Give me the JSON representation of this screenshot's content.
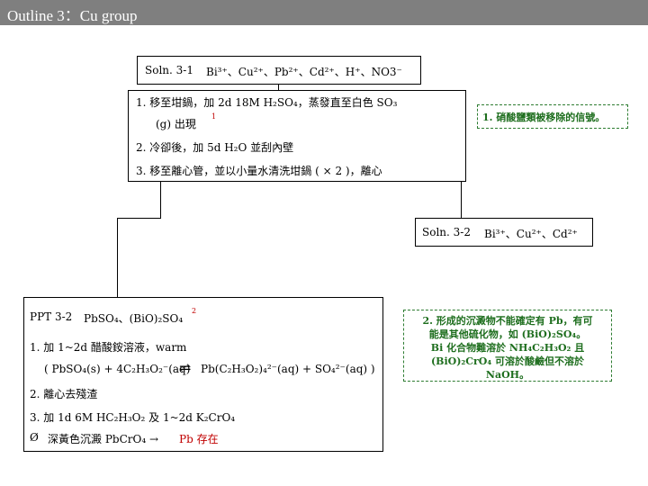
{
  "title": "Outline 3：Cu group",
  "soln31": {
    "label": "Soln. 3-1",
    "ions": "Bi³⁺、Cu²⁺、Pb²⁺、Cd²⁺、H⁺、NO3⁻"
  },
  "step1a": "1. 移至坩鍋，加 2d 18M H₂SO₄，蒸發直至白色 SO₃",
  "step1b": "(g) 出現",
  "step1_ref": "1",
  "step2": "2. 冷卻後，加 5d H₂O 並刮內壁",
  "step3": "3. 移至離心管，並以小量水清洗坩鍋 ( × 2 )，離心",
  "note1": "1. 硝酸鹽類被移除的信號。",
  "soln32": {
    "label": "Soln. 3-2",
    "ions": "Bi³⁺、Cu²⁺、Cd²⁺"
  },
  "ppt32": {
    "label": "PPT 3-2",
    "species": "PbSO₄、(BiO)₂SO₄",
    "ref": "2"
  },
  "ppt_step1": "1. 加 1~2d 醋酸銨溶液，warm",
  "equation": {
    "left": "( PbSO₄(s) + 4C₂H₃O₂⁻(aq)",
    "arrow": "⇌",
    "right": "Pb(C₂H₃O₂)₄²⁻(aq) + SO₄²⁻(aq) )"
  },
  "ppt_step2": "2. 離心去殘渣",
  "ppt_step3": "3. 加 1d 6M HC₂H₃O₂ 及 1~2d K₂CrO₄",
  "ppt_result": {
    "bullet": "Ø",
    "text": "深黃色沉澱 PbCrO₄ → ",
    "highlight": "Pb 存在"
  },
  "note2": [
    "2. 形成的沉澱物不能確定有 Pb，有可",
    "能是其他硫化物，如 (BiO)₂SO₄。",
    "Bi 化合物難溶於 NH₄C₂H₃O₂ 且",
    "(BiO)₂CrO₄ 可溶於酸鹼但不溶於",
    "NaOH。"
  ],
  "colors": {
    "titlebar": "#7f7f7f",
    "text": "#1f3a7a",
    "note_border": "#2e7d32",
    "highlight": "#c00000"
  }
}
